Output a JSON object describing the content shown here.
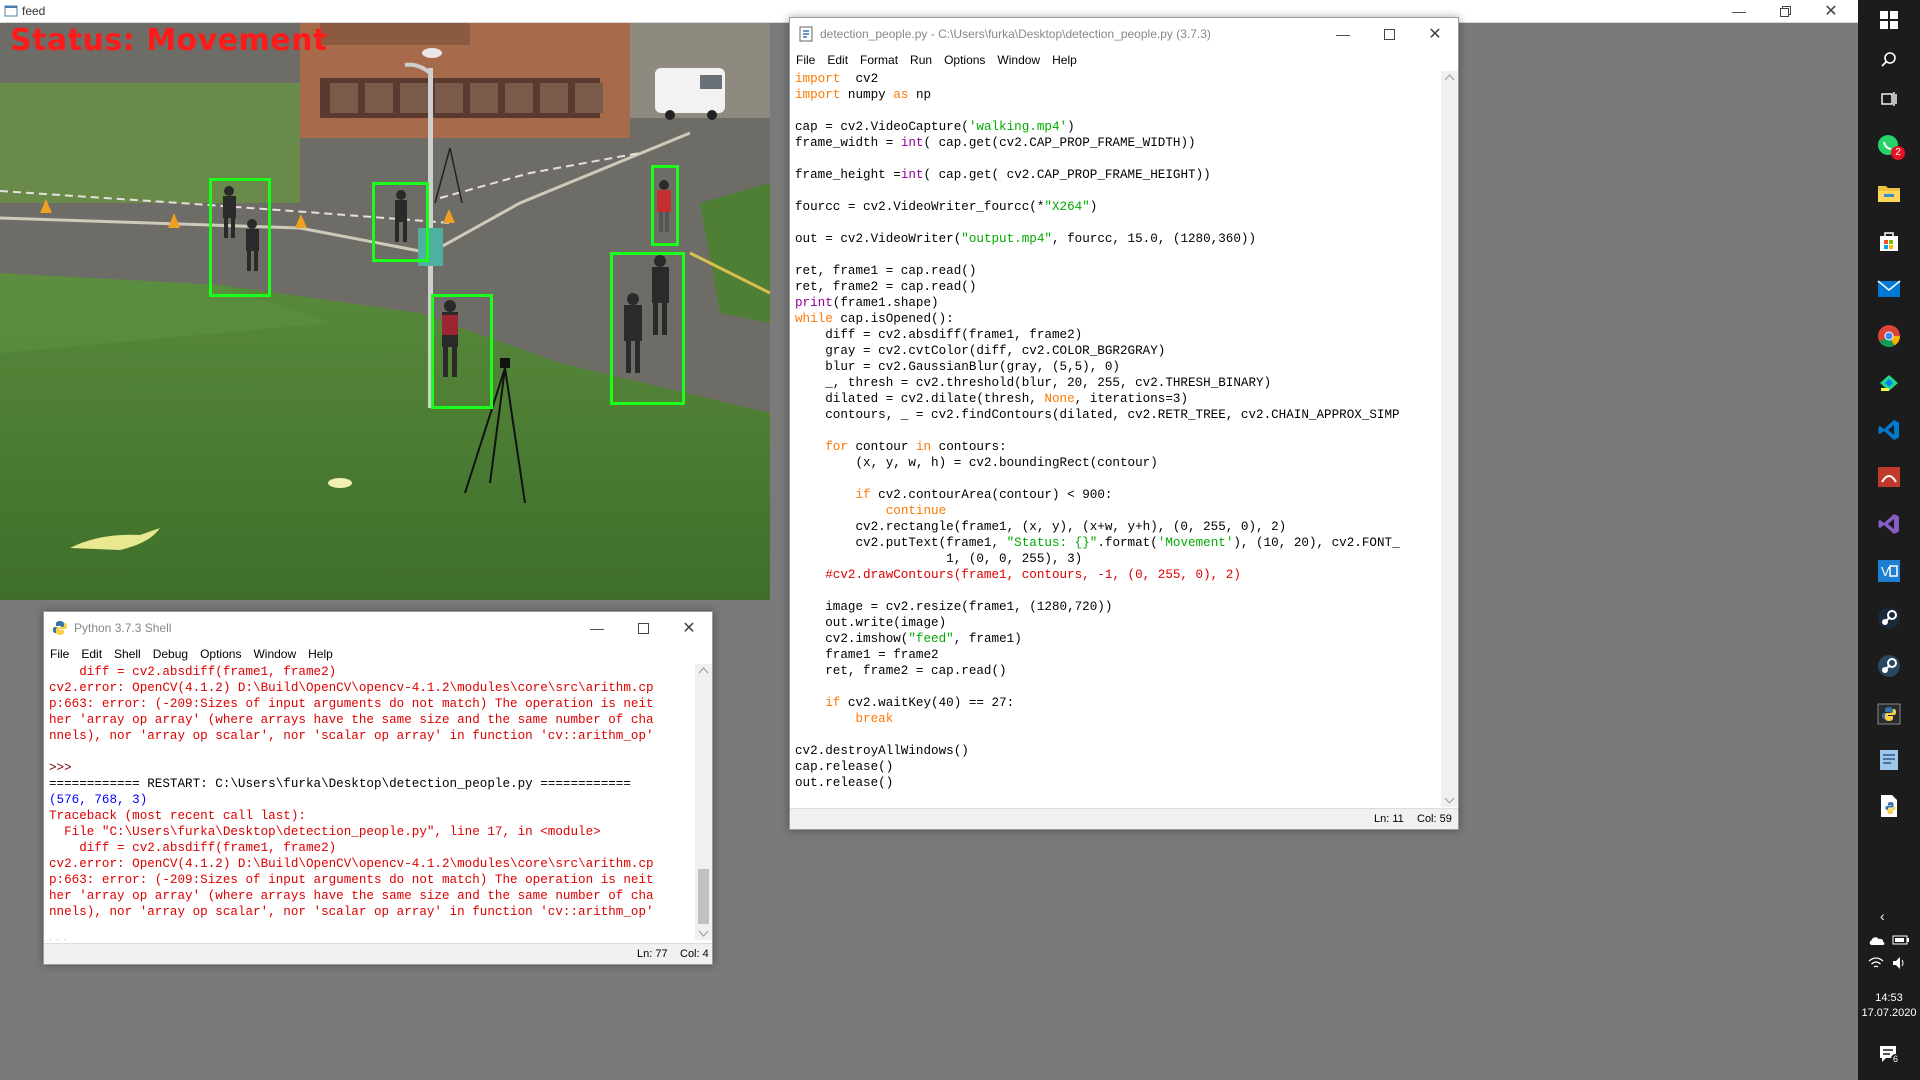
{
  "feed": {
    "title": "feed",
    "status": "Status: Movement"
  },
  "editor": {
    "title": "detection_people.py - C:\\Users\\furka\\Desktop\\detection_people.py (3.7.3)",
    "menu": [
      "File",
      "Edit",
      "Format",
      "Run",
      "Options",
      "Window",
      "Help"
    ],
    "code": [
      [
        [
          "kw",
          "import"
        ],
        [
          "",
          "  cv2"
        ]
      ],
      [
        [
          "kw",
          "import"
        ],
        [
          "",
          " numpy "
        ],
        [
          "kw",
          "as"
        ],
        [
          "",
          " np"
        ]
      ],
      [],
      [
        [
          "",
          "cap = cv2.VideoCapture("
        ],
        [
          "str",
          "'walking.mp4'"
        ],
        [
          "",
          ")"
        ]
      ],
      [
        [
          "",
          "frame_width = "
        ],
        [
          "bi",
          "int"
        ],
        [
          "",
          "( cap.get(cv2.CAP_PROP_FRAME_WIDTH))"
        ]
      ],
      [],
      [
        [
          "",
          "frame_height ="
        ],
        [
          "bi",
          "int"
        ],
        [
          "",
          "( cap.get( cv2.CAP_PROP_FRAME_HEIGHT))"
        ]
      ],
      [],
      [
        [
          "",
          "fourcc = cv2.VideoWriter_fourcc(*"
        ],
        [
          "str",
          "\"X264\""
        ],
        [
          "",
          ")"
        ]
      ],
      [],
      [
        [
          "",
          "out = cv2.VideoWriter("
        ],
        [
          "str",
          "\"output.mp4\""
        ],
        [
          "",
          ", fourcc, 15.0, (1280,360))"
        ]
      ],
      [],
      [
        [
          "",
          "ret, frame1 = cap.read()"
        ]
      ],
      [
        [
          "",
          "ret, frame2 = cap.read()"
        ]
      ],
      [
        [
          "bi",
          "print"
        ],
        [
          "",
          "(frame1.shape)"
        ]
      ],
      [
        [
          "kw",
          "while"
        ],
        [
          "",
          " cap.isOpened():"
        ]
      ],
      [
        [
          "",
          "    diff = cv2.absdiff(frame1, frame2)"
        ]
      ],
      [
        [
          "",
          "    gray = cv2.cvtColor(diff, cv2.COLOR_BGR2GRAY)"
        ]
      ],
      [
        [
          "",
          "    blur = cv2.GaussianBlur(gray, (5,5), 0)"
        ]
      ],
      [
        [
          "",
          "    _, thresh = cv2.threshold(blur, 20, 255, cv2.THRESH_BINARY)"
        ]
      ],
      [
        [
          "",
          "    dilated = cv2.dilate(thresh, "
        ],
        [
          "kw",
          "None"
        ],
        [
          "",
          ", iterations=3)"
        ]
      ],
      [
        [
          "",
          "    contours, _ = cv2.findContours(dilated, cv2.RETR_TREE, cv2.CHAIN_APPROX_SIMP"
        ]
      ],
      [],
      [
        [
          "",
          "    "
        ],
        [
          "kw",
          "for"
        ],
        [
          "",
          " contour "
        ],
        [
          "kw",
          "in"
        ],
        [
          "",
          " contours:"
        ]
      ],
      [
        [
          "",
          "        (x, y, w, h) = cv2.boundingRect(contour)"
        ]
      ],
      [],
      [
        [
          "",
          "        "
        ],
        [
          "kw",
          "if"
        ],
        [
          "",
          " cv2.contourArea(contour) < 900:"
        ]
      ],
      [
        [
          "",
          "            "
        ],
        [
          "kw",
          "continue"
        ]
      ],
      [
        [
          "",
          "        cv2.rectangle(frame1, (x, y), (x+w, y+h), (0, 255, 0), 2)"
        ]
      ],
      [
        [
          "",
          "        cv2.putText(frame1, "
        ],
        [
          "str",
          "\"Status: {}\""
        ],
        [
          "",
          ".format("
        ],
        [
          "str",
          "'Movement'"
        ],
        [
          "",
          "), (10, 20), cv2.FONT_"
        ]
      ],
      [
        [
          "",
          "                    1, (0, 0, 255), 3)"
        ]
      ],
      [
        [
          "cm",
          "    #cv2.drawContours(frame1, contours, -1, (0, 255, 0), 2)"
        ]
      ],
      [],
      [
        [
          "",
          "    image = cv2.resize(frame1, (1280,720))"
        ]
      ],
      [
        [
          "",
          "    out.write(image)"
        ]
      ],
      [
        [
          "",
          "    cv2.imshow("
        ],
        [
          "str",
          "\"feed\""
        ],
        [
          "",
          ", frame1)"
        ]
      ],
      [
        [
          "",
          "    frame1 = frame2"
        ]
      ],
      [
        [
          "",
          "    ret, frame2 = cap.read()"
        ]
      ],
      [],
      [
        [
          "",
          "    "
        ],
        [
          "kw",
          "if"
        ],
        [
          "",
          " cv2.waitKey(40) == 27:"
        ]
      ],
      [
        [
          "",
          "        "
        ],
        [
          "kw",
          "break"
        ]
      ],
      [],
      [
        [
          "",
          "cv2.destroyAllWindows()"
        ]
      ],
      [
        [
          "",
          "cap.release()"
        ]
      ],
      [
        [
          "",
          "out.release()"
        ]
      ]
    ],
    "status_ln": "Ln: 11",
    "status_col": "Col: 59"
  },
  "shell": {
    "title": "Python 3.7.3 Shell",
    "menu": [
      "File",
      "Edit",
      "Shell",
      "Debug",
      "Options",
      "Window",
      "Help"
    ],
    "lines": [
      [
        [
          "err",
          "    diff = cv2.absdiff(frame1, frame2)"
        ]
      ],
      [
        [
          "err",
          "cv2.error: OpenCV(4.1.2) D:\\Build\\OpenCV\\opencv-4.1.2\\modules\\core\\src\\arithm.cp"
        ]
      ],
      [
        [
          "err",
          "p:663: error: (-209:Sizes of input arguments do not match) The operation is neit"
        ]
      ],
      [
        [
          "err",
          "her 'array op array' (where arrays have the same size and the same number of cha"
        ]
      ],
      [
        [
          "err",
          "nnels), nor 'array op scalar', nor 'scalar op array' in function 'cv::arithm_op'"
        ]
      ],
      [],
      [
        [
          "prompt",
          ">>>"
        ]
      ],
      [
        [
          "",
          "============ RESTART: C:\\Users\\furka\\Desktop\\detection_people.py ============"
        ]
      ],
      [
        [
          "out",
          "(576, 768, 3)"
        ]
      ],
      [
        [
          "err",
          "Traceback (most recent call last):"
        ]
      ],
      [
        [
          "err",
          "  File \"C:\\Users\\furka\\Desktop\\detection_people.py\", line 17, in <module>"
        ]
      ],
      [
        [
          "err",
          "    diff = cv2.absdiff(frame1, frame2)"
        ]
      ],
      [
        [
          "err",
          "cv2.error: OpenCV(4.1.2) D:\\Build\\OpenCV\\opencv-4.1.2\\modules\\core\\src\\arithm.cp"
        ]
      ],
      [
        [
          "err",
          "p:663: error: (-209:Sizes of input arguments do not match) The operation is neit"
        ]
      ],
      [
        [
          "err",
          "her 'array op array' (where arrays have the same size and the same number of cha"
        ]
      ],
      [
        [
          "err",
          "nnels), nor 'array op scalar', nor 'scalar op array' in function 'cv::arithm_op'"
        ]
      ],
      [],
      [
        [
          "prompt",
          ">>>"
        ]
      ]
    ],
    "status_ln": "Ln: 77",
    "status_col": "Col: 4"
  },
  "taskbar": {
    "time": "14:53",
    "date": "17.07.2020",
    "notification_count": "6",
    "badge_count": "2",
    "icons": [
      "windows-start-icon",
      "search-icon",
      "task-view-icon",
      "whatsapp-icon",
      "file-explorer-icon",
      "store-icon",
      "mail-icon",
      "chrome-icon",
      "ide-icon",
      "vscode-icon",
      "game-icon",
      "visual-studio-icon",
      "vmware-icon",
      "steam-icon",
      "steam-alt-icon",
      "python-icon",
      "notepad-icon",
      "python-file-icon"
    ]
  }
}
